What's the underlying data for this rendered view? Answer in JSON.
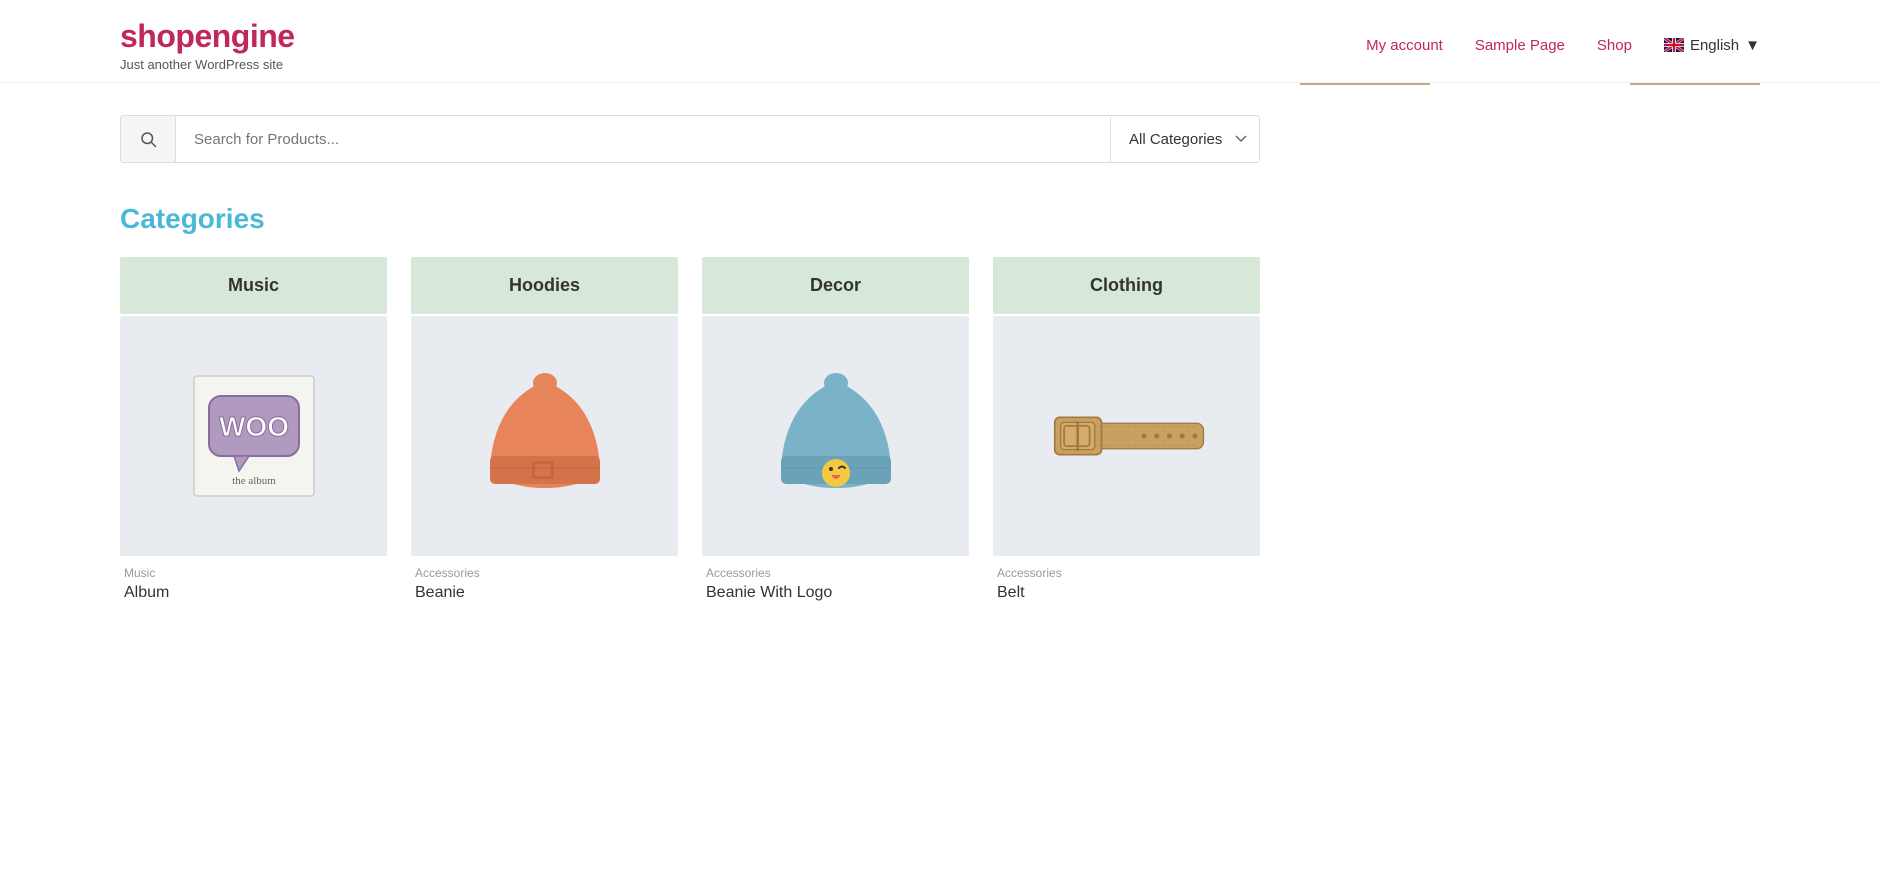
{
  "header": {
    "logo_title": "shopengine",
    "logo_subtitle": "Just another WordPress site",
    "nav": {
      "my_account": "My account",
      "sample_page": "Sample Page",
      "shop": "Shop",
      "language": "English"
    }
  },
  "search": {
    "placeholder": "Search for Products...",
    "category_label": "All Categories"
  },
  "categories": {
    "section_title": "Categories",
    "items": [
      {
        "label": "Music"
      },
      {
        "label": "Hoodies"
      },
      {
        "label": "Decor"
      },
      {
        "label": "Clothing"
      }
    ]
  },
  "products": [
    {
      "category_tag": "Music",
      "name": "Album",
      "type": "album"
    },
    {
      "category_tag": "Accessories",
      "name": "Beanie",
      "type": "beanie"
    },
    {
      "category_tag": "Accessories",
      "name": "Beanie With Logo",
      "type": "beanie-logo"
    },
    {
      "category_tag": "Accessories",
      "name": "Belt",
      "type": "belt"
    }
  ]
}
